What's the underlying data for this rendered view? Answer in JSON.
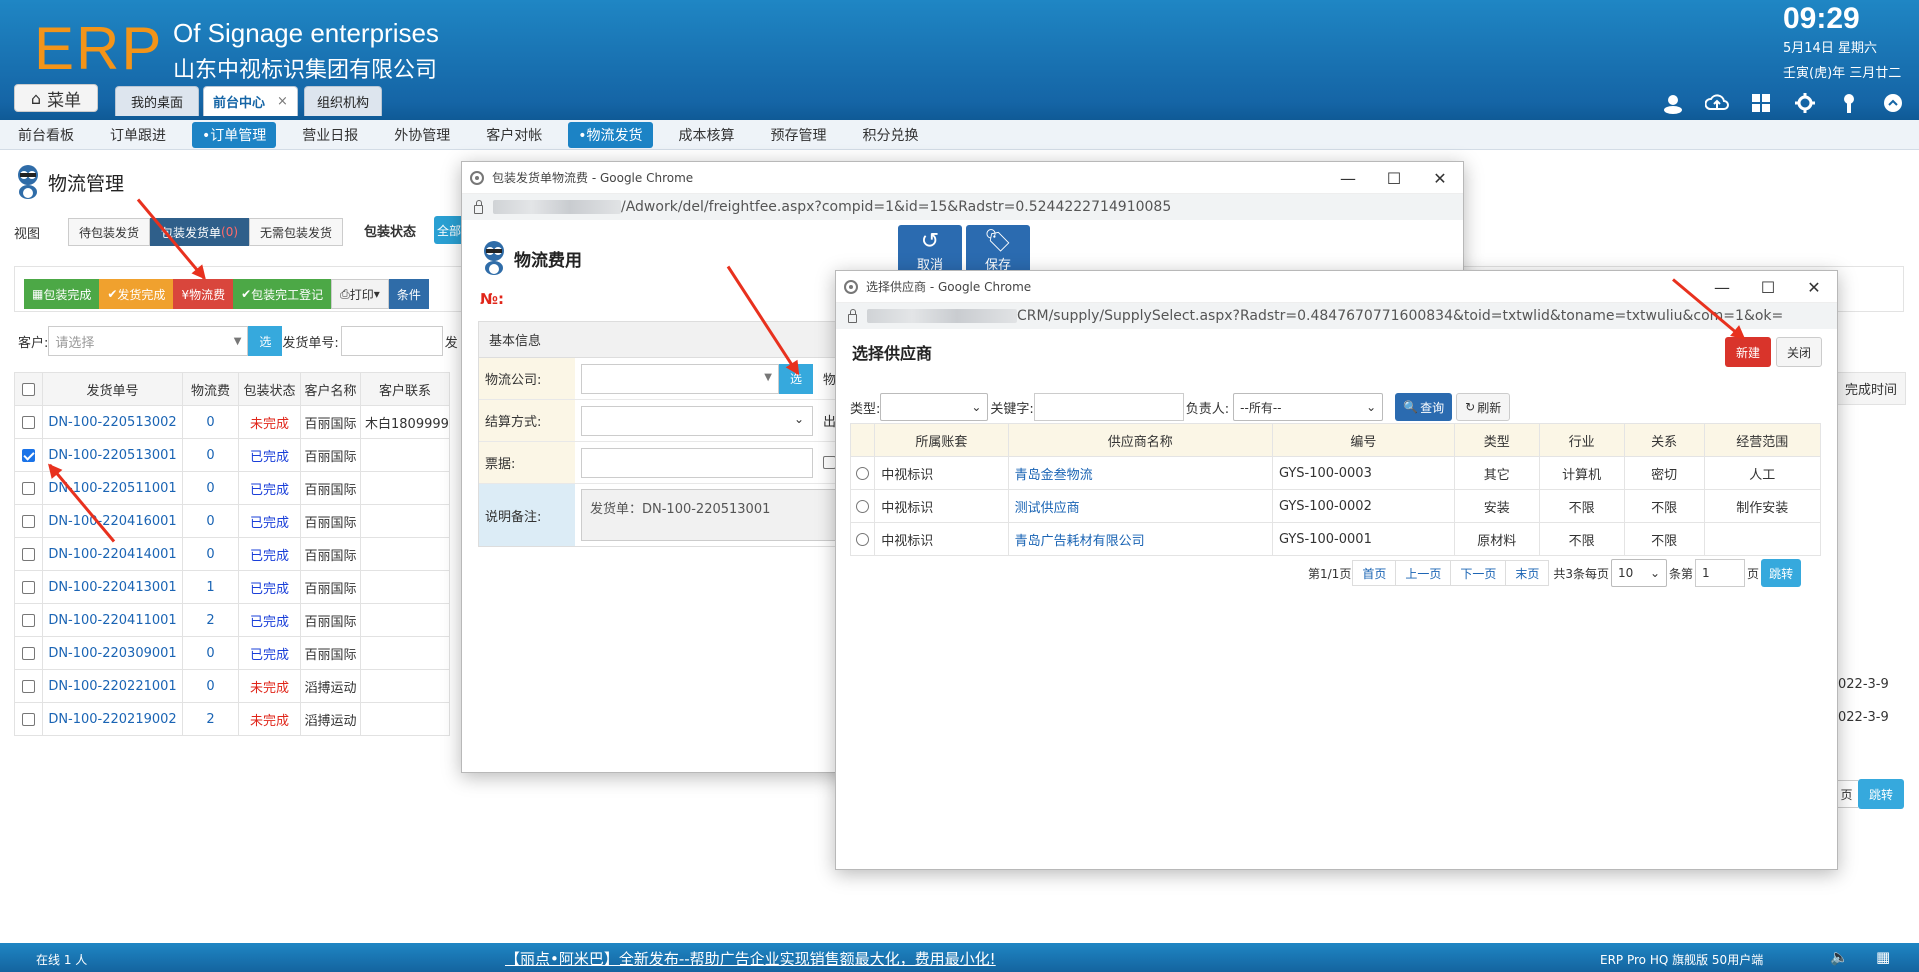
{
  "header": {
    "logo": "ERP",
    "brand_en": "Of Signage enterprises",
    "brand_cn": "山东中视标识集团有限公司",
    "time": "09:29",
    "date": "5月14日 星期六",
    "lunar": "壬寅(虎)年 三月廿二",
    "menu_label": "菜单",
    "tabs": [
      {
        "label": "我的桌面"
      },
      {
        "label": "前台中心",
        "close": "×"
      },
      {
        "label": "组织机构"
      }
    ],
    "icons": [
      "user-icon",
      "cloud-upload-icon",
      "grid-icon",
      "gear-icon",
      "key-icon",
      "chevron-up-icon"
    ]
  },
  "nav": {
    "items": [
      "前台看板",
      "订单跟进",
      "•订单管理",
      "营业日报",
      "外协管理",
      "客户对帐",
      "•物流发货",
      "成本核算",
      "预存管理",
      "积分兑换"
    ],
    "active": [
      "•订单管理",
      "•物流发货"
    ]
  },
  "page": {
    "title": "物流管理",
    "view_label": "视图",
    "view_tabs": [
      "待包装发货",
      "包装发货单",
      "无需包装发货"
    ],
    "view_badge": "(0)",
    "package_state_label": "包装状态",
    "package_state_all": "全部",
    "toolbar": [
      "包装完成",
      "发货完成",
      "¥物流费",
      "包装完工登记",
      "打印",
      "条件"
    ],
    "filter": {
      "customer_label": "客户:",
      "customer_placeholder": "请选择",
      "select_btn": "选",
      "ship_no_label": "发货单号:",
      "cut_label": "发"
    },
    "table": {
      "columns": [
        "发货单号",
        "物流费",
        "包装状态",
        "客户名称",
        "客户联系"
      ],
      "rows": [
        {
          "no": "DN-100-220513002",
          "fee": "0",
          "status": "未完成",
          "done": false,
          "customer": "百丽国际",
          "contact": "木白1809999",
          "checked": false
        },
        {
          "no": "DN-100-220513001",
          "fee": "0",
          "status": "已完成",
          "done": true,
          "customer": "百丽国际",
          "contact": "",
          "checked": true
        },
        {
          "no": "DN-100-220511001",
          "fee": "0",
          "status": "已完成",
          "done": true,
          "customer": "百丽国际",
          "contact": "",
          "checked": false
        },
        {
          "no": "DN-100-220416001",
          "fee": "0",
          "status": "已完成",
          "done": true,
          "customer": "百丽国际",
          "contact": "",
          "checked": false
        },
        {
          "no": "DN-100-220414001",
          "fee": "0",
          "status": "已完成",
          "done": true,
          "customer": "百丽国际",
          "contact": "",
          "checked": false
        },
        {
          "no": "DN-100-220413001",
          "fee": "1",
          "status": "已完成",
          "done": true,
          "customer": "百丽国际",
          "contact": "",
          "checked": false
        },
        {
          "no": "DN-100-220411001",
          "fee": "2",
          "status": "已完成",
          "done": true,
          "customer": "百丽国际",
          "contact": "",
          "checked": false
        },
        {
          "no": "DN-100-220309001",
          "fee": "0",
          "status": "已完成",
          "done": true,
          "customer": "百丽国际",
          "contact": "",
          "checked": false
        },
        {
          "no": "DN-100-220221001",
          "fee": "0",
          "status": "未完成",
          "done": false,
          "customer": "滔搏运动",
          "contact": "",
          "checked": false
        },
        {
          "no": "DN-100-220219002",
          "fee": "2",
          "status": "未完成",
          "done": false,
          "customer": "滔搏运动",
          "contact": "",
          "checked": false
        }
      ]
    },
    "right_col_header": "完成时间",
    "right_dates": [
      "022-3-9",
      "022-3-9"
    ],
    "right_page_label": "页",
    "right_jump": "跳转"
  },
  "status_bar": {
    "online": "在线  1  人",
    "marquee": "【丽点•阿米巴】全新发布--帮助广告企业实现销售额最大化，费用最小化!",
    "version": "ERP Pro HQ 旗舰版 50用户端"
  },
  "window1": {
    "title": "包装发货单物流费 - Google Chrome",
    "url": "/Adwork/del/freightfee.aspx?compid=1&id=15&Radstr=0.5244222714910085",
    "heading": "物流费用",
    "cancel": "取消",
    "save": "保存",
    "no_label": "№:",
    "section": "基本信息",
    "fields": [
      {
        "label": "物流公司:",
        "select_btn": "选",
        "cut": "物"
      },
      {
        "label": "结算方式:",
        "cut": "出"
      },
      {
        "label": "票据:"
      },
      {
        "label": "说明备注:",
        "value": "发货单：DN-100-220513001"
      }
    ]
  },
  "window2": {
    "title": "选择供应商 - Google Chrome",
    "url": "CRM/supply/SupplySelect.aspx?Radstr=0.4847670771600834&toid=txtwlid&toname=txtwuliu&com=1&ok=",
    "heading": "选择供应商",
    "new_btn": "新建",
    "close_btn": "关闭",
    "filter": {
      "type_label": "类型:",
      "keyword_label": "关键字:",
      "owner_label": "负责人:",
      "owner_value": "--所有--",
      "query": "查询",
      "refresh": "刷新"
    },
    "columns": [
      "所属账套",
      "供应商名称",
      "编号",
      "类型",
      "行业",
      "关系",
      "经营范围"
    ],
    "rows": [
      {
        "book": "中视标识",
        "name": "青岛金叁物流",
        "code": "GYS-100-0003",
        "type": "其它",
        "industry": "计算机",
        "relation": "密切",
        "scope": "人工"
      },
      {
        "book": "中视标识",
        "name": "测试供应商",
        "code": "GYS-100-0002",
        "type": "安装",
        "industry": "不限",
        "relation": "不限",
        "scope": "制作安装"
      },
      {
        "book": "中视标识",
        "name": "青岛广告耗材有限公司",
        "code": "GYS-100-0001",
        "type": "原材料",
        "industry": "不限",
        "relation": "不限",
        "scope": ""
      }
    ],
    "pager": {
      "page_info": "第1/1页",
      "first": "首页",
      "prev": "上一页",
      "next": "下一页",
      "last": "末页",
      "total": "共3条每页",
      "per_page": "10",
      "unit": "条第",
      "page_input": "1",
      "page_unit": "页",
      "jump": "跳转"
    }
  },
  "colors": {
    "header_blue": "#1565a6",
    "logo_orange": "#f39419",
    "arrow_red": "#e8311e",
    "link_blue": "#1a64b4",
    "done_blue": "#1a3fd9",
    "not_done_red": "#e0261a"
  }
}
